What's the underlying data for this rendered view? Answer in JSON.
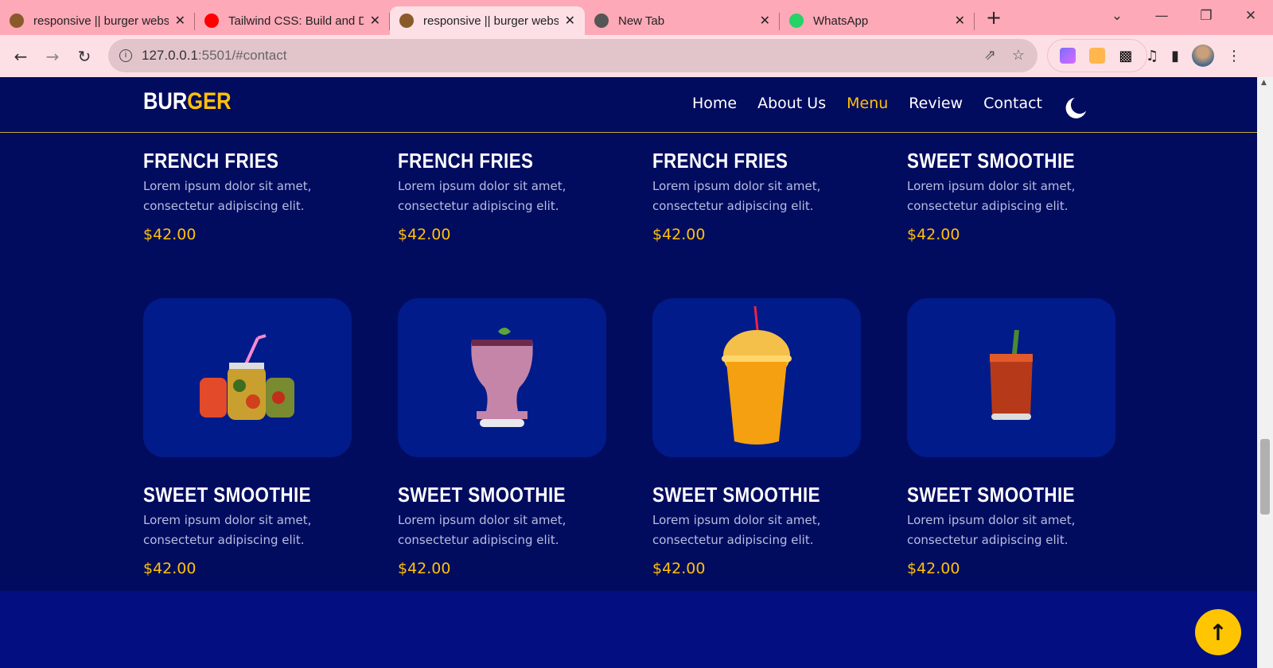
{
  "browser": {
    "tabs": [
      {
        "title": "responsive || burger webs",
        "icon": "burger-favicon",
        "color": "#8a5a2b"
      },
      {
        "title": "Tailwind CSS: Build and De",
        "icon": "youtube-icon",
        "color": "#ff0000"
      },
      {
        "title": "responsive || burger webs",
        "icon": "burger-favicon",
        "color": "#8a5a2b",
        "active": true
      },
      {
        "title": "New Tab",
        "icon": "chrome-icon",
        "color": "#555555"
      },
      {
        "title": "WhatsApp",
        "icon": "whatsapp-icon",
        "color": "#25d366"
      }
    ],
    "new_tab": "+",
    "url_host": "127.0.0.1",
    "url_rest": ":5501/#contact"
  },
  "site": {
    "logo_a": "BUR",
    "logo_b": "GER",
    "nav": [
      {
        "label": "Home"
      },
      {
        "label": "About Us"
      },
      {
        "label": "Menu",
        "active": true
      },
      {
        "label": "Review"
      },
      {
        "label": "Contact"
      }
    ],
    "accent": "#ffc107",
    "bg": "#020c5f"
  },
  "menu_top": [
    {
      "name": "FRENCH FRIES",
      "desc": "Lorem ipsum dolor sit amet, consectetur adipiscing elit.",
      "price": "$42.00"
    },
    {
      "name": "FRENCH FRIES",
      "desc": "Lorem ipsum dolor sit amet, consectetur adipiscing elit.",
      "price": "$42.00"
    },
    {
      "name": "FRENCH FRIES",
      "desc": "Lorem ipsum dolor sit amet, consectetur adipiscing elit.",
      "price": "$42.00"
    },
    {
      "name": "SWEET SMOOTHIE",
      "desc": "Lorem ipsum dolor sit amet, consectetur adipiscing elit.",
      "price": "$42.00"
    }
  ],
  "menu_bottom": [
    {
      "name": "SWEET SMOOTHIE",
      "desc": "Lorem ipsum dolor sit amet, consectetur adipiscing elit.",
      "price": "$42.00",
      "image": "fruit-jars"
    },
    {
      "name": "SWEET SMOOTHIE",
      "desc": "Lorem ipsum dolor sit amet, consectetur adipiscing elit.",
      "price": "$42.00",
      "image": "berry-smoothie"
    },
    {
      "name": "SWEET SMOOTHIE",
      "desc": "Lorem ipsum dolor sit amet, consectetur adipiscing elit.",
      "price": "$42.00",
      "image": "mango-smoothie"
    },
    {
      "name": "SWEET SMOOTHIE",
      "desc": "Lorem ipsum dolor sit amet, consectetur adipiscing elit.",
      "price": "$42.00",
      "image": "tomato-juice"
    }
  ]
}
